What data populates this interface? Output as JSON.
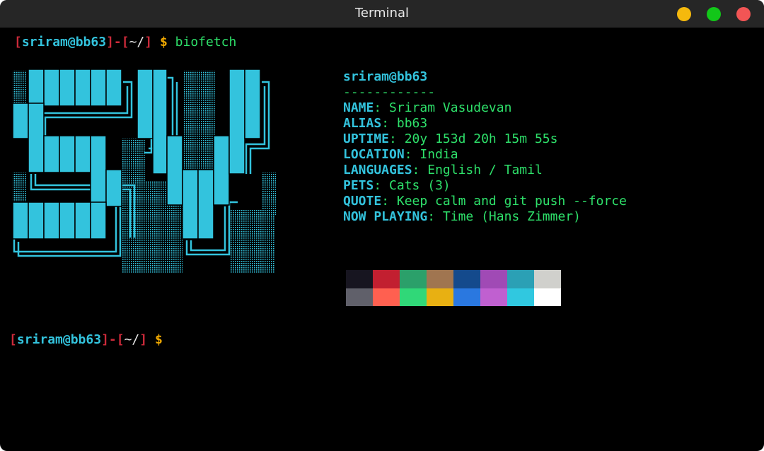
{
  "window": {
    "title": "Terminal",
    "buttons": {
      "minimize": "#f5b90d",
      "maximize": "#12c719",
      "close": "#f25555"
    }
  },
  "prompt": {
    "open_bracket": "[",
    "user_host": "sriram@bb63",
    "middle": "]-[",
    "dir": "~/",
    "close_bracket": "]",
    "dollar": "$",
    "command": "biofetch"
  },
  "info": {
    "hostname": "sriram@bb63",
    "separator": "------------",
    "rows": [
      {
        "key": "NAME",
        "value": "Sriram Vasudevan"
      },
      {
        "key": "ALIAS",
        "value": "bb63"
      },
      {
        "key": "UPTIME",
        "value": "20y 153d 20h 15m 55s"
      },
      {
        "key": "LOCATION",
        "value": "India"
      },
      {
        "key": "LANGUAGES",
        "value": "English / Tamil"
      },
      {
        "key": "PETS",
        "value": "Cats (3)"
      },
      {
        "key": "QUOTE",
        "value": "Keep calm and git push --force"
      },
      {
        "key": "NOW PLAYING",
        "value": "Time (Hans Zimmer)"
      }
    ]
  },
  "palette": {
    "normal": [
      "#171520",
      "#c21f30",
      "#2ba06a",
      "#a07550",
      "#144a8c",
      "#a04ab5",
      "#2ba0b5",
      "#d0d0cc"
    ],
    "bright": [
      "#60606a",
      "#ff6050",
      "#30d878",
      "#e8b012",
      "#2a78e0",
      "#c060d0",
      "#30c8e0",
      "#ffffff"
    ]
  },
  "colors": {
    "background": "#000000",
    "accent_cyan": "#33c3dd",
    "accent_green": "#2ee06a",
    "bracket_red": "#cc2a3a",
    "dollar_yellow": "#f0a800"
  },
  "logo": {
    "icon": "sv-ascii-logo"
  }
}
